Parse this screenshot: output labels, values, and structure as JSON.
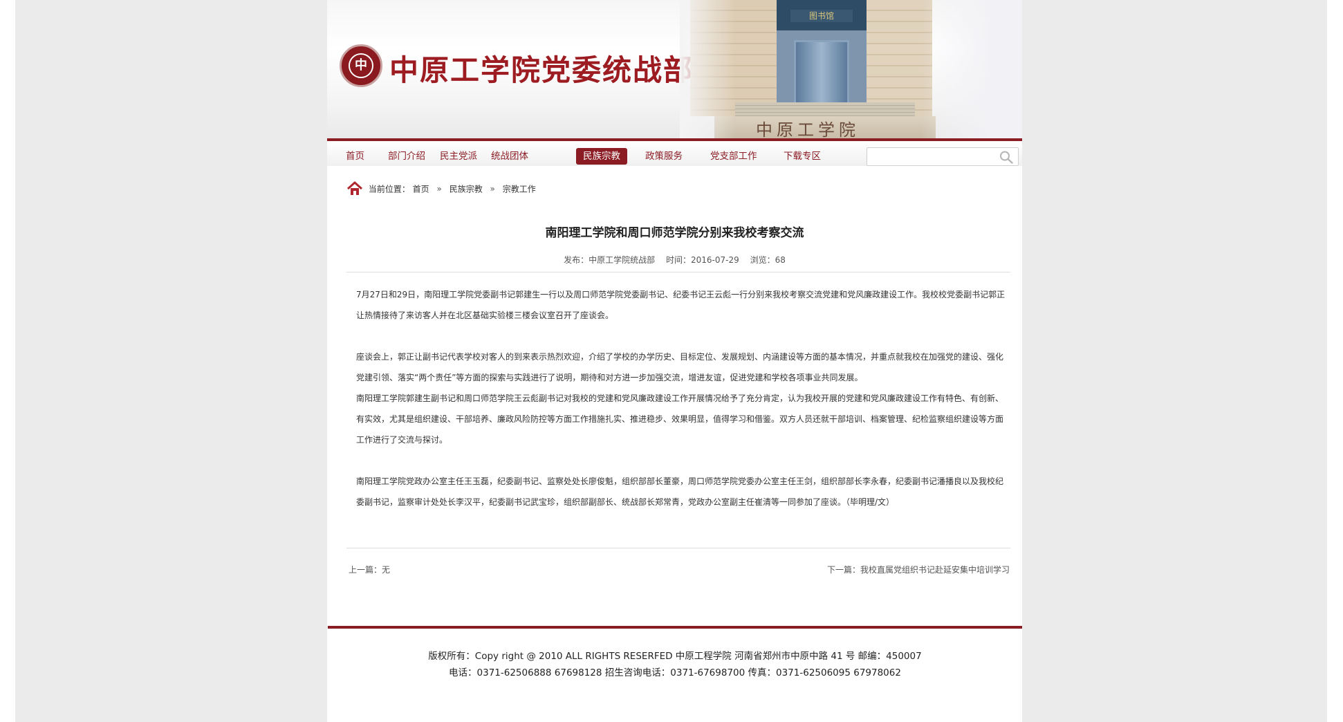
{
  "header": {
    "logo_text": "中原工学院",
    "site_name": "中原工学院党委统战部",
    "building_sign": "图书馆",
    "building_base_text": "中原工学院"
  },
  "nav": {
    "items": [
      {
        "label": "首页",
        "active": false
      },
      {
        "label": "部门介绍",
        "active": false
      },
      {
        "label": "民主党派",
        "active": false
      },
      {
        "label": "统战团体",
        "active": false
      },
      {
        "label": "民族宗教",
        "active": true
      },
      {
        "label": "政策服务",
        "active": false
      },
      {
        "label": "党支部工作",
        "active": false
      },
      {
        "label": "下载专区",
        "active": false
      }
    ],
    "search": {
      "value": "",
      "placeholder": ""
    }
  },
  "breadcrumb": {
    "prefix": "当前位置：",
    "items": [
      "首页",
      "民族宗教",
      "宗教工作"
    ],
    "separator": "»"
  },
  "article": {
    "title": "南阳理工学院和周口师范学院分别来我校考察交流",
    "meta": {
      "publisher": "发布：中原工学院统战部",
      "time": "时间：2016-07-29",
      "views": "浏览：68"
    },
    "paragraphs": [
      "7月27日和29日，南阳理工学院党委副书记郭建生一行以及周口师范学院党委副书记、纪委书记王云彪一行分别来我校考察交流党建和党风廉政建设工作。我校校党委副书记郭正让热情接待了来访客人并在北区基础实验楼三楼会议室召开了座谈会。",
      "座谈会上，郭正让副书记代表学校对客人的到来表示热烈欢迎，介绍了学校的办学历史、目标定位、发展规划、内涵建设等方面的基本情况，并重点就我校在加强党的建设、强化党建引领、落实“两个责任”等方面的探索与实践进行了说明，期待和对方进一步加强交流，增进友谊，促进党建和学校各项事业共同发展。",
      "南阳理工学院郭建生副书记和周口师范学院王云彪副书记对我校的党建和党风廉政建设工作开展情况给予了充分肯定，认为我校开展的党建和党风廉政建设工作有特色、有创新、有实效，尤其是组织建设、干部培养、廉政风险防控等方面工作措施扎实、推进稳步、效果明显，值得学习和借鉴。双方人员还就干部培训、档案管理、纪检监察组织建设等方面工作进行了交流与探讨。",
      "南阳理工学院党政办公室主任王玉磊，纪委副书记、监察处处长廖俊魁，组织部部长董豪，周口师范学院党委办公室主任王剑，组织部部长李永春，纪委副书记潘播良以及我校纪委副书记，监察审计处处长李汉平，纪委副书记武宝珍，组织部副部长、统战部长郑常青，党政办公室副主任崔清等一同参加了座谈。（毕明理/文）"
    ],
    "prev": {
      "label": "上一篇：",
      "title": "无"
    },
    "next": {
      "label": "下一篇：",
      "title": "我校直属党组织书记赴延安集中培训学习"
    }
  },
  "footer": {
    "line1": "版权所有：Copy right @ 2010 ALL RIGHTS RESERFED     中原工程学院     河南省郑州市中原中路 41 号     邮编：450007",
    "line2": "电话：0371-62506888     67698128     招生咨询电话：0371-67698700     传真：0371-62506095 67978062"
  },
  "colors": {
    "brand": "#8b1c24",
    "page_side": "#ebebeb"
  },
  "icons": [
    "home-icon",
    "search-icon"
  ]
}
